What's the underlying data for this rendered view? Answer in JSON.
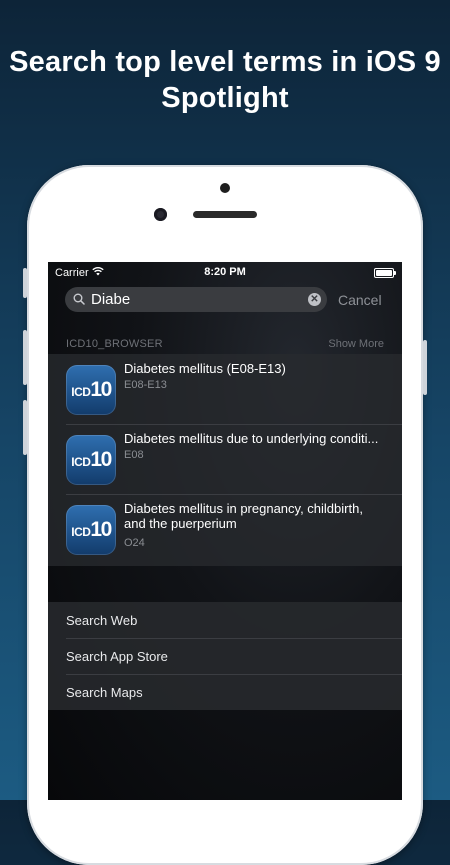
{
  "headline": "Search top level terms in iOS 9 Spotlight",
  "status_bar": {
    "carrier": "Carrier",
    "time": "8:20 PM"
  },
  "search": {
    "query": "Diabe",
    "cancel_label": "Cancel"
  },
  "section": {
    "name": "ICD10_BROWSER",
    "show_more": "Show More"
  },
  "app_icon_text": {
    "prefix": "ICD",
    "number": "10"
  },
  "results": [
    {
      "title": "Diabetes mellitus (E08-E13)",
      "code": "E08-E13"
    },
    {
      "title": "Diabetes mellitus due to underlying conditi...",
      "code": "E08"
    },
    {
      "title": "Diabetes mellitus in pregnancy, childbirth, and the puerperium",
      "code": "O24"
    }
  ],
  "web_search": [
    {
      "label": "Search Web"
    },
    {
      "label": "Search App Store"
    },
    {
      "label": "Search Maps"
    }
  ],
  "colors": {
    "background_top": "#0d2438",
    "background_bottom": "#1c5b82",
    "icon_blue": "#2f6fb0"
  }
}
